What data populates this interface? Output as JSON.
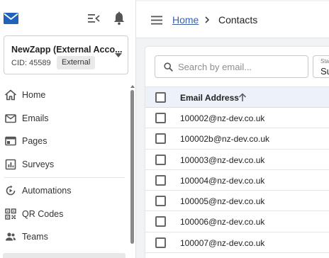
{
  "account": {
    "name": "NewZapp (External Acco...",
    "cid": "CID: 45589",
    "badge": "External"
  },
  "nav": {
    "items": [
      {
        "label": "Home",
        "icon": "home-icon"
      },
      {
        "label": "Emails",
        "icon": "mail-icon"
      },
      {
        "label": "Pages",
        "icon": "pages-icon"
      },
      {
        "label": "Surveys",
        "icon": "survey-icon"
      },
      {
        "label": "Automations",
        "icon": "automation-icon"
      },
      {
        "label": "QR Codes",
        "icon": "qr-code-icon"
      },
      {
        "label": "Teams",
        "icon": "teams-icon"
      }
    ]
  },
  "breadcrumb": {
    "home": "Home",
    "current": "Contacts"
  },
  "search": {
    "placeholder": "Search by email..."
  },
  "status_filter": {
    "label": "Sta",
    "value": "Su"
  },
  "table": {
    "header": "Email Address",
    "rows": [
      "100002@nz-dev.co.uk",
      "100002b@nz-dev.co.uk",
      "100003@nz-dev.co.uk",
      "100004@nz-dev.co.uk",
      "100005@nz-dev.co.uk",
      "100006@nz-dev.co.uk",
      "100007@nz-dev.co.uk"
    ]
  },
  "colors": {
    "brand": "#1e63b8",
    "link": "#3b5fa6",
    "table_header_bg": "#edf2fa",
    "main_bg": "#f1f3f5"
  }
}
